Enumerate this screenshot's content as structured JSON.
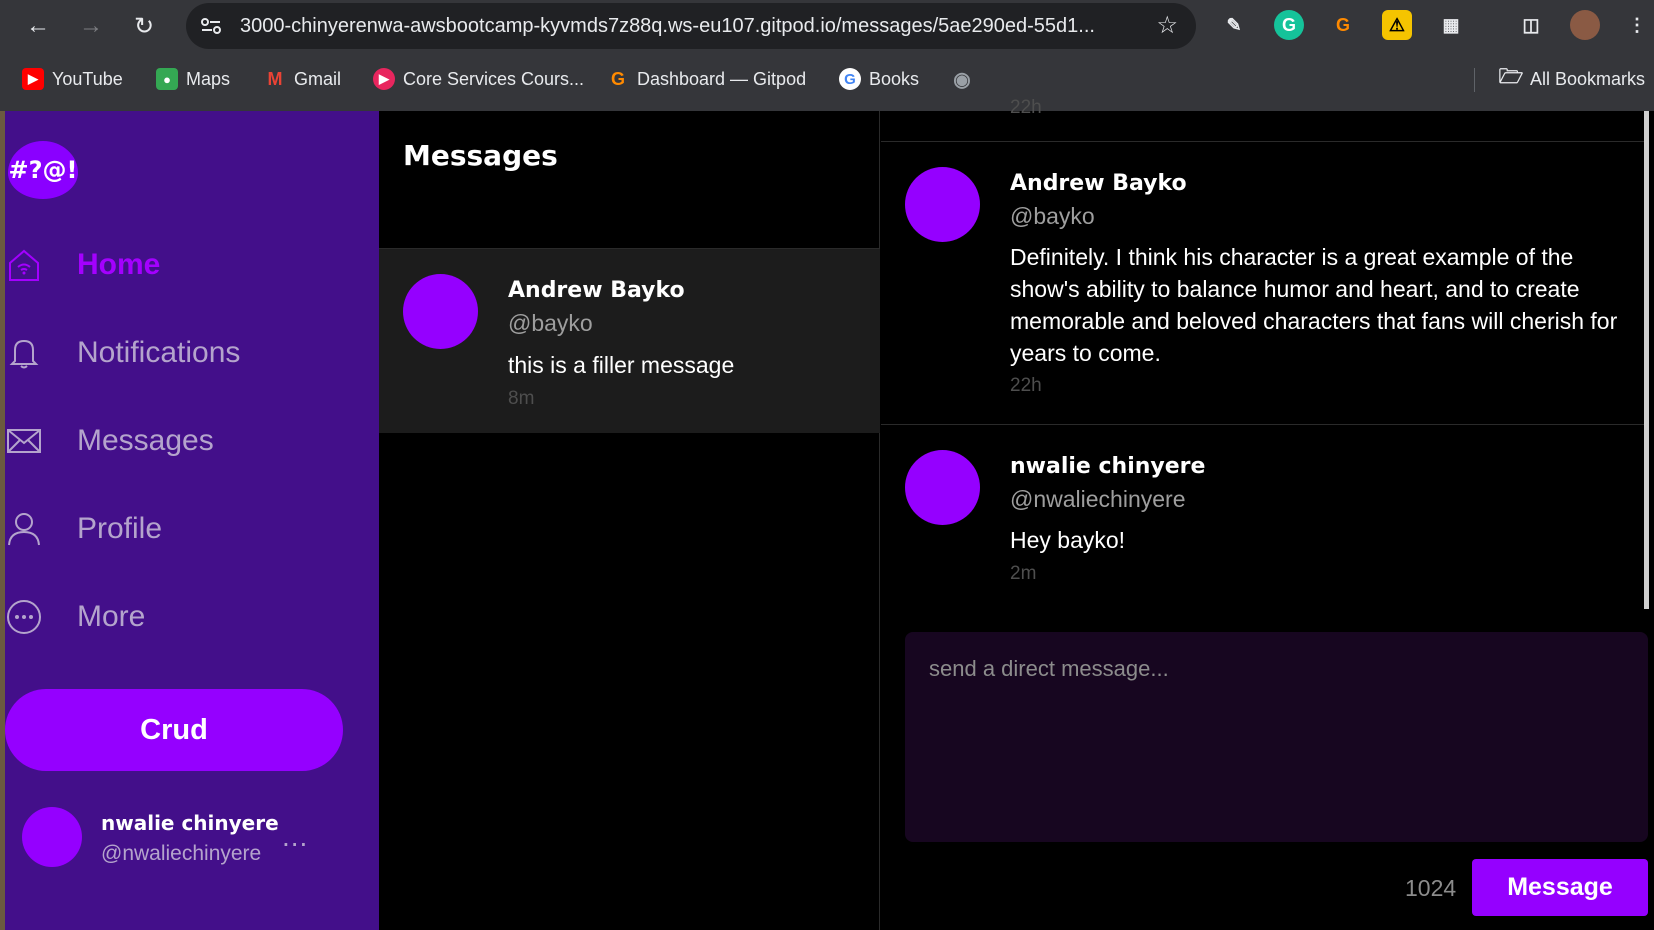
{
  "browser": {
    "url": "3000-chinyerenwa-awsbootcamp-kyvmds7z88q.ws-eu107.gitpod.io/messages/5ae290ed-55d1...",
    "bookmarks": [
      {
        "label": "YouTube",
        "icon": "youtube-icon",
        "color": "#ff0000"
      },
      {
        "label": "Maps",
        "icon": "maps-icon",
        "color": "#34a853"
      },
      {
        "label": "Gmail",
        "icon": "gmail-icon",
        "color": "#ea4335"
      },
      {
        "label": "Core Services Cours...",
        "icon": "course-icon",
        "color": "#e8265e"
      },
      {
        "label": "Dashboard — Gitpod",
        "icon": "gitpod-icon",
        "color": "#ff8a00"
      },
      {
        "label": "Books",
        "icon": "google-icon",
        "color": "#4285f4"
      },
      {
        "label": "",
        "icon": "globe-icon",
        "color": "#9aa0a6"
      }
    ],
    "all_bookmarks": "All Bookmarks"
  },
  "app": {
    "logo": "#?@!",
    "nav": [
      {
        "label": "Home",
        "icon": "home-icon",
        "active": true
      },
      {
        "label": "Notifications",
        "icon": "bell-icon",
        "active": false
      },
      {
        "label": "Messages",
        "icon": "envelope-icon",
        "active": false
      },
      {
        "label": "Profile",
        "icon": "person-icon",
        "active": false
      },
      {
        "label": "More",
        "icon": "more-circle-icon",
        "active": false
      }
    ],
    "crud_label": "Crud",
    "current_user": {
      "name": "nwalie chinyere",
      "handle": "@nwaliechinyere",
      "menu": "..."
    },
    "colors": {
      "accent": "#9500ff",
      "sidebar": "#430f8a"
    }
  },
  "messages_list": {
    "title": "Messages",
    "conversations": [
      {
        "name": "Andrew Bayko",
        "handle": "@bayko",
        "text": "this is a filler message",
        "time": "8m"
      }
    ]
  },
  "thread": {
    "partial_time": "22h",
    "messages": [
      {
        "name": "Andrew Bayko",
        "handle": "@bayko",
        "text": "Definitely. I think his character is a great example of the show's ability to balance humor and heart, and to create memorable and beloved characters that fans will cherish for years to come.",
        "time": "22h"
      },
      {
        "name": "nwalie chinyere",
        "handle": "@nwaliechinyere",
        "text": "Hey bayko!",
        "time": "2m"
      }
    ],
    "compose_placeholder": "send a direct message...",
    "char_count": "1024",
    "send_label": "Message"
  }
}
